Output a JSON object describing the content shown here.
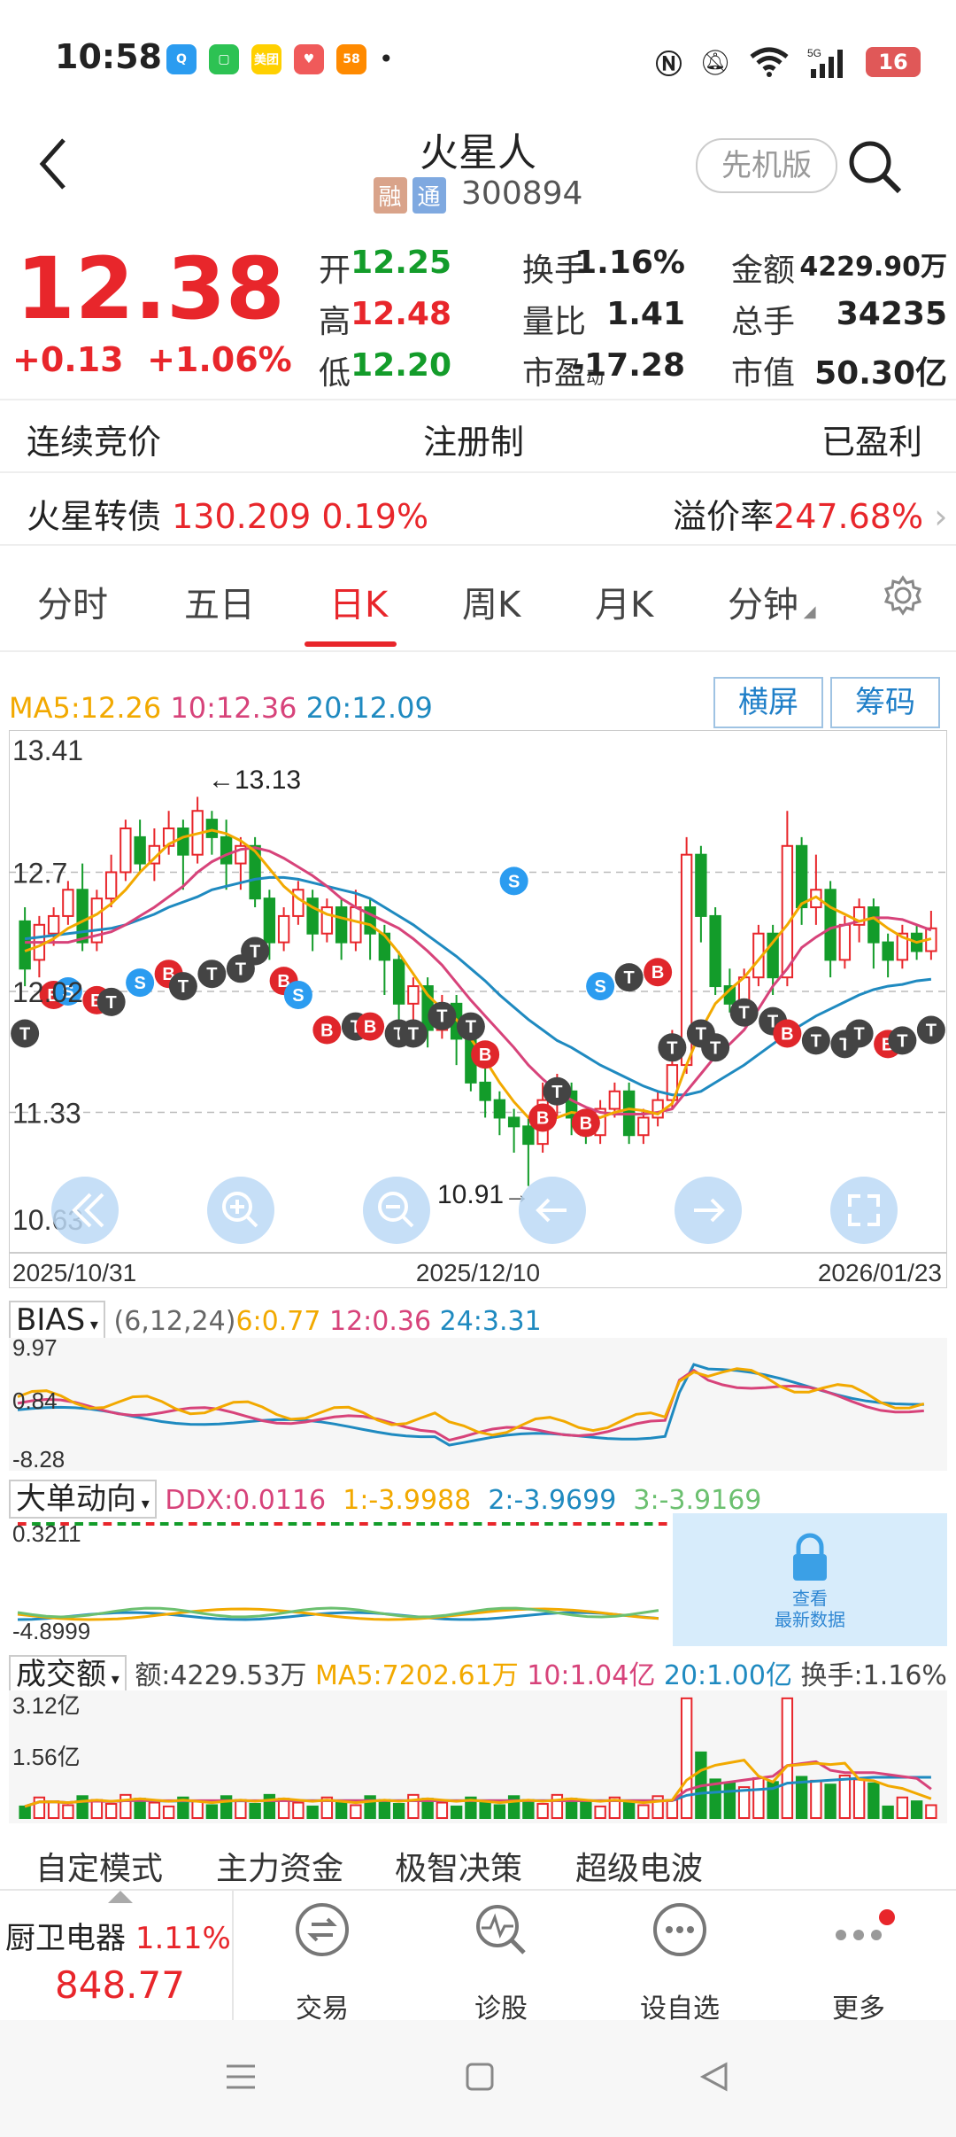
{
  "status": {
    "time": "10:58",
    "apps": [
      {
        "name": "qq-browser-icon",
        "text": "Q",
        "color": "#2b9cf0"
      },
      {
        "name": "wechat-icon",
        "text": "▢",
        "color": "#2dc253"
      },
      {
        "name": "meituan-icon",
        "text": "美团",
        "color": "#ffd000"
      },
      {
        "name": "app-red-icon",
        "text": "♥",
        "color": "#f05a5a"
      },
      {
        "name": "app-58-icon",
        "text": "58",
        "color": "#ff8a00"
      }
    ],
    "dot": "•",
    "battery": "16"
  },
  "header": {
    "title": "火星人",
    "tag1": "融",
    "tag2": "通",
    "code": "300894",
    "version_btn": "先机版"
  },
  "quote": {
    "price": "12.38",
    "change": "+0.13",
    "change_pct": "+1.06%",
    "rows": [
      [
        {
          "l": "开",
          "v": "12.25",
          "c": "g"
        },
        {
          "l": "换手",
          "v": "1.16%",
          "c": "d"
        },
        {
          "l": "金额",
          "v": "4229.90万",
          "c": "d"
        }
      ],
      [
        {
          "l": "高",
          "v": "12.48",
          "c": "r"
        },
        {
          "l": "量比",
          "v": "1.41",
          "c": "d"
        },
        {
          "l": "总手",
          "v": "34235",
          "c": "d"
        }
      ],
      [
        {
          "l": "低",
          "v": "12.20",
          "c": "gg"
        },
        {
          "l": "市盈动",
          "v": "-17.28",
          "c": "d"
        },
        {
          "l": "市值",
          "v": "50.30亿",
          "c": "d"
        }
      ]
    ]
  },
  "info": {
    "left": "连续竞价",
    "mid": "注册制",
    "right": "已盈利"
  },
  "bond": {
    "name": "火星转债",
    "price": "130.209",
    "pct": "0.19%",
    "premium_label": "溢价率",
    "premium": "247.68%"
  },
  "tabs": [
    "分时",
    "五日",
    "日K",
    "周K",
    "月K",
    "分钟"
  ],
  "ma": {
    "ma5": "MA5:12.26",
    "ma10": "10:12.36",
    "ma20": "20:12.09",
    "colors": {
      "ma5": "#f2a900",
      "ma10": "#d7437a",
      "ma20": "#1f8ac0"
    }
  },
  "buttons": {
    "landscape": "横屏",
    "chips": "筹码"
  },
  "kchart": {
    "y_labels": [
      "13.41",
      "12.7",
      "12.02",
      "11.33",
      "10.63"
    ],
    "dates": [
      "2025/10/31",
      "2025/12/10",
      "2026/01/23"
    ],
    "high_mark": "←13.13",
    "low_mark": "10.91→",
    "candles": [
      [
        12.42,
        12.15,
        12.5,
        12.05
      ],
      [
        12.2,
        12.4,
        12.45,
        12.1
      ],
      [
        12.35,
        12.45,
        12.5,
        12.28
      ],
      [
        12.45,
        12.6,
        12.65,
        12.4
      ],
      [
        12.6,
        12.3,
        12.75,
        12.25
      ],
      [
        12.3,
        12.55,
        12.6,
        12.25
      ],
      [
        12.55,
        12.7,
        12.8,
        12.5
      ],
      [
        12.7,
        12.95,
        13.0,
        12.65
      ],
      [
        12.9,
        12.75,
        13.0,
        12.7
      ],
      [
        12.75,
        12.85,
        12.95,
        12.65
      ],
      [
        12.85,
        12.95,
        13.05,
        12.8
      ],
      [
        12.95,
        12.8,
        13.0,
        12.6
      ],
      [
        12.8,
        13.05,
        13.13,
        12.75
      ],
      [
        13.0,
        12.9,
        13.05,
        12.8
      ],
      [
        12.9,
        12.75,
        13.0,
        12.6
      ],
      [
        12.75,
        12.85,
        12.9,
        12.6
      ],
      [
        12.85,
        12.55,
        12.9,
        12.5
      ],
      [
        12.55,
        12.3,
        12.6,
        12.2
      ],
      [
        12.3,
        12.45,
        12.5,
        12.25
      ],
      [
        12.45,
        12.6,
        12.65,
        12.4
      ],
      [
        12.55,
        12.35,
        12.6,
        12.25
      ],
      [
        12.35,
        12.5,
        12.55,
        12.3
      ],
      [
        12.5,
        12.3,
        12.55,
        12.2
      ],
      [
        12.3,
        12.5,
        12.6,
        12.25
      ],
      [
        12.5,
        12.35,
        12.55,
        12.2
      ],
      [
        12.35,
        12.2,
        12.4,
        12.0
      ],
      [
        12.2,
        11.95,
        12.25,
        11.85
      ],
      [
        11.95,
        12.05,
        12.1,
        11.85
      ],
      [
        12.05,
        11.8,
        12.1,
        11.7
      ],
      [
        11.8,
        11.95,
        12.0,
        11.75
      ],
      [
        11.95,
        11.75,
        12.0,
        11.6
      ],
      [
        11.75,
        11.5,
        11.8,
        11.45
      ],
      [
        11.5,
        11.4,
        11.6,
        11.3
      ],
      [
        11.4,
        11.3,
        11.45,
        11.2
      ],
      [
        11.3,
        11.25,
        11.35,
        11.1
      ],
      [
        11.25,
        11.15,
        11.3,
        10.91
      ],
      [
        11.15,
        11.4,
        11.5,
        11.1
      ],
      [
        11.4,
        11.45,
        11.55,
        11.3
      ],
      [
        11.45,
        11.3,
        11.5,
        11.2
      ],
      [
        11.3,
        11.2,
        11.35,
        11.15
      ],
      [
        11.2,
        11.35,
        11.4,
        11.15
      ],
      [
        11.35,
        11.45,
        11.5,
        11.3
      ],
      [
        11.45,
        11.2,
        11.5,
        11.15
      ],
      [
        11.2,
        11.3,
        11.35,
        11.15
      ],
      [
        11.3,
        11.4,
        11.45,
        11.25
      ],
      [
        11.4,
        11.6,
        11.8,
        11.35
      ],
      [
        11.6,
        12.8,
        12.9,
        11.55
      ],
      [
        12.8,
        12.45,
        12.85,
        12.3
      ],
      [
        12.45,
        12.05,
        12.5,
        12.0
      ],
      [
        12.05,
        11.95,
        12.15,
        11.9
      ],
      [
        11.95,
        12.1,
        12.15,
        11.9
      ],
      [
        12.1,
        12.35,
        12.4,
        12.05
      ],
      [
        12.35,
        12.1,
        12.4,
        12.0
      ],
      [
        12.1,
        12.85,
        13.05,
        12.05
      ],
      [
        12.85,
        12.5,
        12.9,
        12.4
      ],
      [
        12.5,
        12.6,
        12.8,
        12.4
      ],
      [
        12.6,
        12.2,
        12.65,
        12.1
      ],
      [
        12.2,
        12.4,
        12.45,
        12.15
      ],
      [
        12.4,
        12.5,
        12.55,
        12.3
      ],
      [
        12.5,
        12.3,
        12.55,
        12.15
      ],
      [
        12.3,
        12.2,
        12.35,
        12.1
      ],
      [
        12.2,
        12.35,
        12.4,
        12.15
      ],
      [
        12.35,
        12.25,
        12.4,
        12.2
      ],
      [
        12.25,
        12.38,
        12.48,
        12.2
      ]
    ],
    "markers": [
      {
        "i": 0,
        "t": "T",
        "p": 11.78
      },
      {
        "i": 1,
        "t": "B",
        "p": 12.0
      },
      {
        "i": 2,
        "t": "S",
        "p": 12.02
      },
      {
        "i": 3,
        "t": "B",
        "p": 11.97
      },
      {
        "i": 4,
        "t": "T",
        "p": 11.96
      },
      {
        "i": 5,
        "t": "S",
        "p": 12.07
      },
      {
        "i": 6,
        "t": "E",
        "p": 12.12
      },
      {
        "i": 7,
        "t": "T",
        "p": 12.05
      },
      {
        "i": 8,
        "t": "T",
        "p": 12.12
      },
      {
        "i": 9,
        "t": "T",
        "p": 12.15
      },
      {
        "i": 10,
        "t": "T",
        "p": 12.25
      },
      {
        "i": 11,
        "t": "B",
        "p": 12.08
      },
      {
        "i": 12,
        "t": "S",
        "p": 12.0
      },
      {
        "i": 13,
        "t": "E",
        "p": 11.8
      },
      {
        "i": 14,
        "t": "T",
        "p": 11.82
      },
      {
        "i": 15,
        "t": "E",
        "p": 11.82
      },
      {
        "i": 16,
        "t": "T",
        "p": 11.78
      },
      {
        "i": 17,
        "t": "T",
        "p": 11.78
      },
      {
        "i": 18,
        "t": "T",
        "p": 11.88
      },
      {
        "i": 19,
        "t": "T",
        "p": 11.82
      },
      {
        "i": 20,
        "t": "B",
        "p": 11.66
      },
      {
        "i": 21,
        "t": "S",
        "p": 12.65
      },
      {
        "i": 22,
        "t": "B",
        "p": 11.3
      },
      {
        "i": 23,
        "t": "T",
        "p": 11.45
      },
      {
        "i": 24,
        "t": "B",
        "p": 11.27
      },
      {
        "i": 25,
        "t": "S",
        "p": 12.05
      },
      {
        "i": 26,
        "t": "T",
        "p": 12.1
      },
      {
        "i": 27,
        "t": "B",
        "p": 12.13
      },
      {
        "i": 28,
        "t": "T",
        "p": 11.7
      },
      {
        "i": 29,
        "t": "T",
        "p": 11.78
      },
      {
        "i": 30,
        "t": "T",
        "p": 11.7
      },
      {
        "i": 31,
        "t": "T",
        "p": 11.9
      },
      {
        "i": 32,
        "t": "T",
        "p": 11.85
      },
      {
        "i": 33,
        "t": "B",
        "p": 11.78
      },
      {
        "i": 34,
        "t": "T",
        "p": 11.74
      },
      {
        "i": 35,
        "t": "T",
        "p": 11.72
      },
      {
        "i": 36,
        "t": "T",
        "p": 11.78
      },
      {
        "i": 37,
        "t": "E",
        "p": 11.72
      },
      {
        "i": 38,
        "t": "T",
        "p": 11.74
      },
      {
        "i": 39,
        "t": "T",
        "p": 11.8
      }
    ],
    "ma5": [
      12.25,
      12.28,
      12.32,
      12.38,
      12.42,
      12.46,
      12.52,
      12.6,
      12.7,
      12.78,
      12.86,
      12.9,
      12.92,
      12.94,
      12.92,
      12.88,
      12.82,
      12.72,
      12.62,
      12.55,
      12.5,
      12.46,
      12.44,
      12.42,
      12.4,
      12.34,
      12.24,
      12.12,
      12.0,
      11.92,
      11.86,
      11.75,
      11.63,
      11.5,
      11.39,
      11.3,
      11.28,
      11.3,
      11.33,
      11.32,
      11.3,
      11.33,
      11.35,
      11.34,
      11.32,
      11.38,
      11.6,
      11.8,
      11.95,
      12.03,
      12.1,
      12.2,
      12.3,
      12.4,
      12.52,
      12.56,
      12.5,
      12.46,
      12.42,
      12.44,
      12.38,
      12.33,
      12.3,
      12.32
    ],
    "ma10": [
      12.3,
      12.3,
      12.3,
      12.3,
      12.32,
      12.34,
      12.36,
      12.4,
      12.45,
      12.5,
      12.56,
      12.62,
      12.7,
      12.76,
      12.8,
      12.83,
      12.84,
      12.82,
      12.78,
      12.73,
      12.68,
      12.62,
      12.55,
      12.5,
      12.46,
      12.42,
      12.38,
      12.32,
      12.25,
      12.17,
      12.07,
      11.97,
      11.88,
      11.79,
      11.7,
      11.6,
      11.52,
      11.45,
      11.4,
      11.36,
      11.33,
      11.32,
      11.32,
      11.32,
      11.33,
      11.35,
      11.45,
      11.55,
      11.65,
      11.72,
      11.8,
      11.92,
      12.05,
      12.15,
      12.27,
      12.33,
      12.38,
      12.4,
      12.42,
      12.44,
      12.44,
      12.43,
      12.4,
      12.37
    ],
    "ma20": [
      12.32,
      12.33,
      12.34,
      12.35,
      12.36,
      12.37,
      12.38,
      12.4,
      12.43,
      12.46,
      12.5,
      12.53,
      12.56,
      12.6,
      12.62,
      12.64,
      12.66,
      12.67,
      12.67,
      12.66,
      12.64,
      12.62,
      12.6,
      12.58,
      12.55,
      12.5,
      12.45,
      12.4,
      12.34,
      12.28,
      12.22,
      12.15,
      12.08,
      12.0,
      11.93,
      11.86,
      11.8,
      11.74,
      11.7,
      11.65,
      11.6,
      11.56,
      11.52,
      11.48,
      11.45,
      11.43,
      11.43,
      11.45,
      11.5,
      11.55,
      11.6,
      11.66,
      11.72,
      11.78,
      11.83,
      11.88,
      11.92,
      11.96,
      12.0,
      12.03,
      12.05,
      12.06,
      12.08,
      12.09
    ]
  },
  "bias": {
    "name": "BIAS",
    "params": "(6,12,24)",
    "v6": "6:0.77",
    "v12": "12:0.36",
    "v24": "24:3.31",
    "y_labels": [
      "9.97",
      "0.84",
      "-8.28"
    ]
  },
  "ddx": {
    "name": "大单动向",
    "ddx": "DDX:0.0116",
    "v1": "1:-3.9988",
    "v2": "2:-3.9699",
    "v3": "3:-3.9169",
    "y_labels": [
      "0.3211",
      "-4.8999"
    ],
    "lock_text1": "查看",
    "lock_text2": "最新数据"
  },
  "volume": {
    "name": "成交额",
    "amount": "额:4229.53万",
    "ma5": "MA5:7202.61万",
    "ma10": "10:1.04亿",
    "ma20": "20:1.00亿",
    "turnover": "换手:1.16%",
    "y_labels": [
      "3.12亿",
      "1.56亿"
    ]
  },
  "bottom_tabs": [
    "自定模式",
    "主力资金",
    "极智决策",
    "超级电波"
  ],
  "dock": {
    "index_name": "厨卫电器",
    "index_pct": "1.11%",
    "index_value": "848.77",
    "items": [
      "交易",
      "诊股",
      "设自选",
      "更多"
    ]
  }
}
